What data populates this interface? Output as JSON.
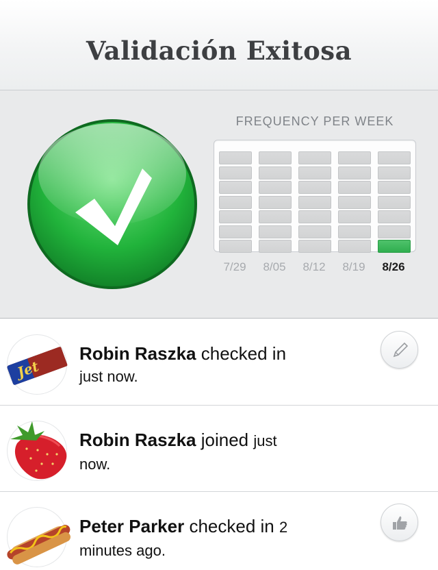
{
  "header": {
    "title": "Validación Exitosa"
  },
  "status": {
    "icon": "checkmark-icon",
    "color": "#2ec84a"
  },
  "chart": {
    "title": "FREQUENCY PER WEEK",
    "accent": "#3cb55a"
  },
  "chart_data": {
    "type": "bar",
    "title": "FREQUENCY PER WEEK",
    "categories": [
      "7/29",
      "8/05",
      "8/12",
      "8/19",
      "8/26"
    ],
    "values": [
      0,
      0,
      0,
      0,
      1
    ],
    "ylim": [
      0,
      7
    ],
    "highlighted_category": "8/26",
    "grid": true
  },
  "feed": {
    "items": [
      {
        "name": "Robin Raszka",
        "action": "checked in",
        "time": "just now.",
        "avatar": "chocolate-bar",
        "button": "pencil-icon"
      },
      {
        "name": "Robin Raszka",
        "action": "joined",
        "time_part1": "just",
        "time_part2": "now.",
        "avatar": "strawberry"
      },
      {
        "name": "Peter Parker",
        "action": "checked in",
        "time_part1": "2",
        "time_part2": "minutes ago.",
        "avatar": "hotdog",
        "button": "thumbs-up-icon"
      }
    ]
  }
}
